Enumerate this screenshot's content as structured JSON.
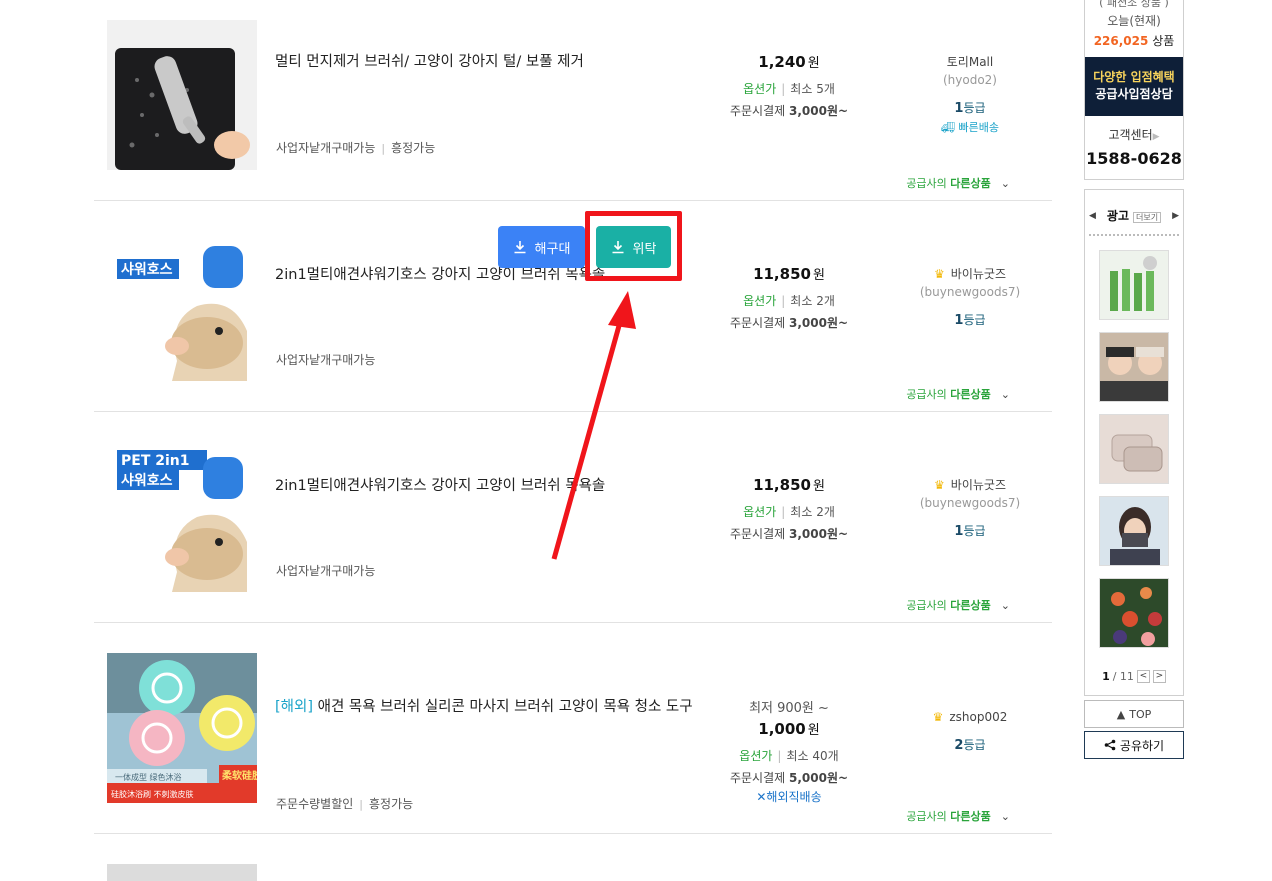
{
  "products": [
    {
      "title": "멀티 먼지제거 브러쉬/ 고양이 강아지 털/ 보풀 제거",
      "oversea_tag": "",
      "tags": [
        "사업자낱개구매가능",
        "흥정가능"
      ],
      "price_min": "",
      "price": "1,240",
      "won": "원",
      "option_label": "옵션가",
      "min_order": "최소 5개",
      "pay_prefix": "주문시결제",
      "pay_amount": "3,000원~",
      "overseas_shipping": "",
      "seller_name": "토리Mall",
      "seller_id": "(hyodo2)",
      "has_crown": false,
      "grade_num": "1",
      "grade_label": "등급",
      "fast_shipping": "빠른배송",
      "more_prefix": "공급사의",
      "more_bold": "다른상품"
    },
    {
      "title": "2in1멀티애견샤워기호스 강아지 고양이 브러쉬 목욕솔",
      "oversea_tag": "",
      "tags": [
        "사업자낱개구매가능"
      ],
      "price_min": "",
      "price": "11,850",
      "won": "원",
      "option_label": "옵션가",
      "min_order": "최소 2개",
      "pay_prefix": "주문시결제",
      "pay_amount": "3,000원~",
      "overseas_shipping": "",
      "seller_name": "바이뉴굿즈",
      "seller_id": "(buynewgoods7)",
      "has_crown": true,
      "grade_num": "1",
      "grade_label": "등급",
      "fast_shipping": "",
      "more_prefix": "공급사의",
      "more_bold": "다른상품"
    },
    {
      "title": "2in1멀티애견샤워기호스 강아지 고양이 브러쉬 목욕솔",
      "oversea_tag": "",
      "tags": [
        "사업자낱개구매가능"
      ],
      "price_min": "",
      "price": "11,850",
      "won": "원",
      "option_label": "옵션가",
      "min_order": "최소 2개",
      "pay_prefix": "주문시결제",
      "pay_amount": "3,000원~",
      "overseas_shipping": "",
      "seller_name": "바이뉴굿즈",
      "seller_id": "(buynewgoods7)",
      "has_crown": true,
      "grade_num": "1",
      "grade_label": "등급",
      "fast_shipping": "",
      "more_prefix": "공급사의",
      "more_bold": "다른상품"
    },
    {
      "title": "애견 목욕 브러쉬 실리콘 마사지 브러쉬 고양이 목욕 청소 도구",
      "oversea_tag": "[해외]",
      "tags": [
        "주문수량별할인",
        "흥정가능"
      ],
      "price_min": "최저 900원 ~",
      "price": "1,000",
      "won": "원",
      "option_label": "옵션가",
      "min_order": "최소 40개",
      "pay_prefix": "주문시결제",
      "pay_amount": "5,000원~",
      "overseas_shipping": "해외직배송",
      "seller_name": "zshop002",
      "seller_id": "",
      "has_crown": true,
      "grade_num": "2",
      "grade_label": "등급",
      "fast_shipping": "",
      "more_prefix": "공급사의",
      "more_bold": "다른상품"
    }
  ],
  "image_text": {
    "pet_2in1": "PET 2in1",
    "shower_hose": "샤워호스",
    "product4_badge": "柔软硅胶",
    "product4_banner": "硅胶沐浴刷 不刺激皮肤",
    "product4_strip": "一体成型 绿色沐浴"
  },
  "overlay": {
    "bulk_label": "해구대",
    "consign_label": "위탁"
  },
  "sidebar": {
    "cut_text": "( 패션조 상품 )",
    "today_label": "오늘(현재)",
    "product_count": "226,025",
    "product_unit": "상품",
    "banner_line1": "다양한 입점혜택",
    "banner_line2": "공급사입점상담",
    "cs_label": "고객센터",
    "cs_phone": "1588-0628",
    "ad_label": "광고",
    "ad_more": "더보기",
    "ad_page": "1",
    "ad_total": "/ 11",
    "top_label": "TOP",
    "share_label": "공유하기"
  },
  "colors": {
    "bulk_button": "#3b82f6",
    "consign_button": "#1ab0a5",
    "highlight": "#f0151b",
    "option_green": "#2aa43b",
    "count_orange": "#f26522",
    "banner_navy": "#0e1f38"
  }
}
